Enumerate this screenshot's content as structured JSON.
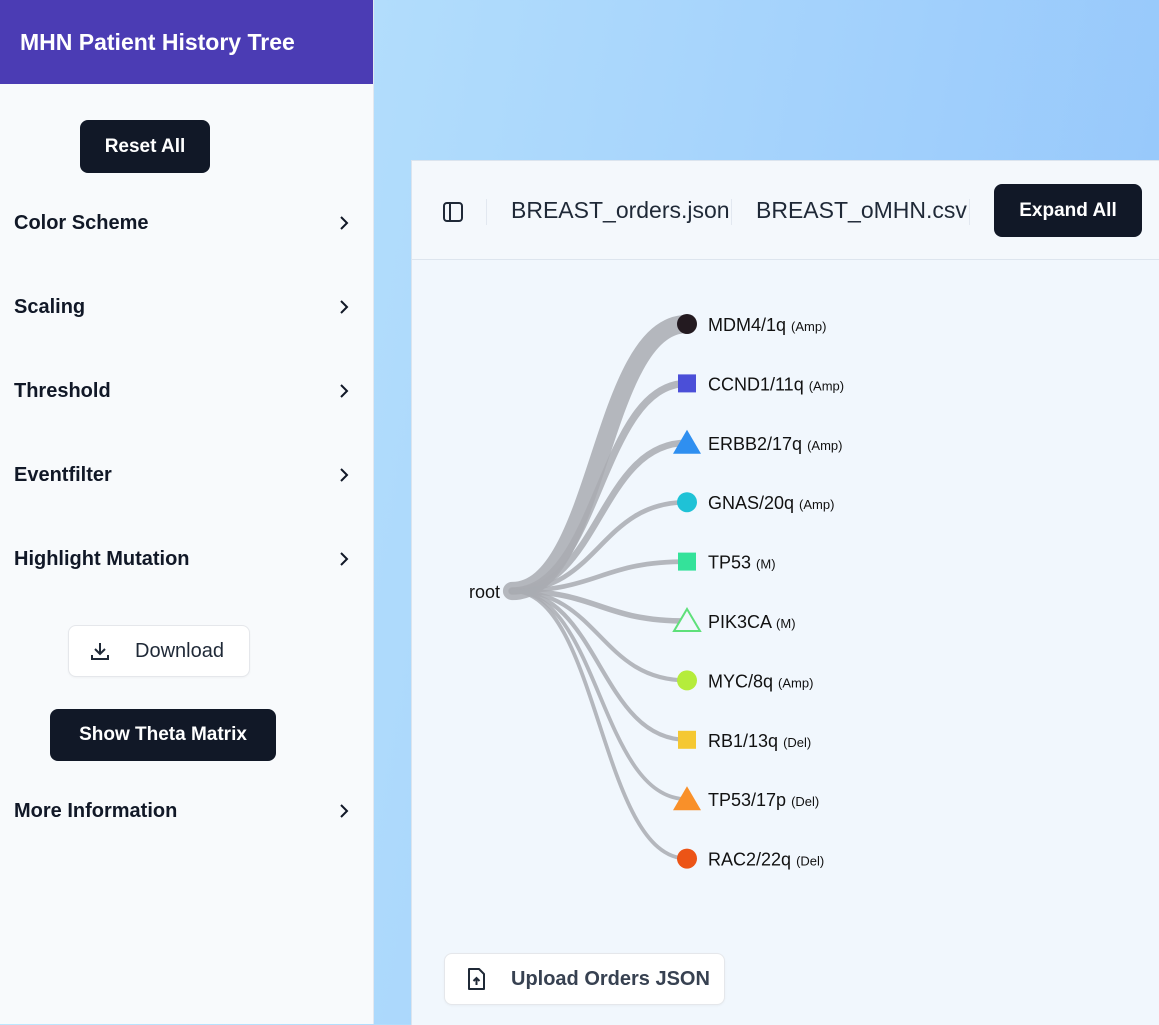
{
  "app": {
    "title": "MHN Patient History Tree"
  },
  "sidebar": {
    "reset_label": "Reset All",
    "sections": [
      {
        "label": "Color Scheme"
      },
      {
        "label": "Scaling"
      },
      {
        "label": "Threshold"
      },
      {
        "label": "Eventfilter"
      },
      {
        "label": "Highlight Mutation"
      }
    ],
    "download_label": "Download",
    "theta_label": "Show Theta Matrix",
    "more_info_label": "More Information"
  },
  "toolbar": {
    "orders_file": "BREAST_orders.json",
    "omhn_file": "BREAST_oMHN.csv",
    "expand_label": "Expand All"
  },
  "tree": {
    "root_label": "root",
    "nodes": [
      {
        "label": "MDM4/1q",
        "type": "(Amp)",
        "shape": "circle",
        "color": "#231a20",
        "weight": 0.9
      },
      {
        "label": "CCND1/11q",
        "type": "(Amp)",
        "shape": "square",
        "color": "#4b4fd8",
        "weight": 0.3
      },
      {
        "label": "ERBB2/17q",
        "type": "(Amp)",
        "shape": "triangle",
        "color": "#2f8ff0",
        "weight": 0.25
      },
      {
        "label": "GNAS/20q",
        "type": "(Amp)",
        "shape": "circle",
        "color": "#1fc2d6",
        "weight": 0.15
      },
      {
        "label": "TP53",
        "type": "(M)",
        "shape": "square",
        "color": "#34e29a",
        "weight": 0.15
      },
      {
        "label": "PIK3CA",
        "type": "(M)",
        "shape": "triangle-outline",
        "color": "#5ee07a",
        "weight": 0.2
      },
      {
        "label": "MYC/8q",
        "type": "(Amp)",
        "shape": "circle",
        "color": "#b5ec3b",
        "weight": 0.12
      },
      {
        "label": "RB1/13q",
        "type": "(Del)",
        "shape": "square",
        "color": "#f5c832",
        "weight": 0.12
      },
      {
        "label": "TP53/17p",
        "type": "(Del)",
        "shape": "triangle",
        "color": "#f99029",
        "weight": 0.1
      },
      {
        "label": "RAC2/22q",
        "type": "(Del)",
        "shape": "circle",
        "color": "#ec5416",
        "weight": 0.1
      }
    ]
  },
  "upload": {
    "label": "Upload Orders JSON"
  }
}
